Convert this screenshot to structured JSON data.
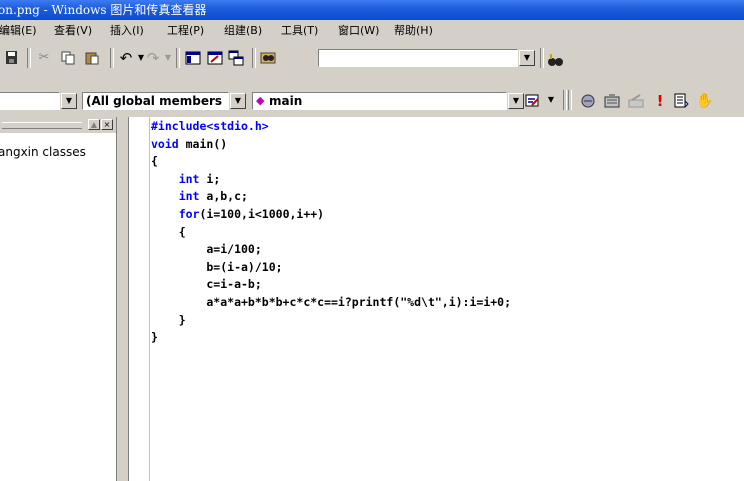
{
  "window": {
    "title": "on.png - Windows 图片和传真查看器"
  },
  "menu": {
    "items": [
      "编辑(E)",
      "查看(V)",
      "插入(I)",
      "工程(P)",
      "组建(B)",
      "工具(T)",
      "窗口(W)",
      "帮助(H)"
    ]
  },
  "toolbar": {
    "find_value": "",
    "icons": [
      "save-all-icon",
      "cut-icon",
      "copy-icon",
      "paste-icon",
      "undo-icon",
      "redo-icon",
      "workspace-icon",
      "output-icon",
      "window-list-icon",
      "find-in-files-icon",
      "find-icon"
    ]
  },
  "wizardbar": {
    "class_value": "",
    "members_value": "(All global members",
    "function_value": "main",
    "build_icons": [
      "compile-icon",
      "build-icon",
      "stop-build-icon",
      "execute-icon",
      "breakpoint-list-icon",
      "hand-icon"
    ]
  },
  "workspace": {
    "tree_item": "angxin classes"
  },
  "editor": {
    "lines": [
      [
        {
          "t": "#include<stdio.h>",
          "kw": true
        }
      ],
      [
        {
          "t": "void",
          "kw": true
        },
        {
          "t": " main()",
          "kw": false
        }
      ],
      [
        {
          "t": "{",
          "kw": false
        }
      ],
      [
        {
          "t": "    ",
          "kw": false
        },
        {
          "t": "int",
          "kw": true
        },
        {
          "t": " i;",
          "kw": false
        }
      ],
      [
        {
          "t": "    ",
          "kw": false
        },
        {
          "t": "int",
          "kw": true
        },
        {
          "t": " a,b,c;",
          "kw": false
        }
      ],
      [
        {
          "t": "    ",
          "kw": false
        },
        {
          "t": "for",
          "kw": true
        },
        {
          "t": "(i=100,i<1000,i++)",
          "kw": false
        }
      ],
      [
        {
          "t": "    {",
          "kw": false
        }
      ],
      [
        {
          "t": "        a=i/100;",
          "kw": false
        }
      ],
      [
        {
          "t": "        b=(i-a)/10;",
          "kw": false
        }
      ],
      [
        {
          "t": "        c=i-a-b;",
          "kw": false
        }
      ],
      [
        {
          "t": "        a*a*a+b*b*b+c*c*c==i?printf(\"%d\\t\",i):i=i+0;",
          "kw": false
        }
      ],
      [
        {
          "t": "    }",
          "kw": false
        }
      ],
      [
        {
          "t": "}",
          "kw": false
        }
      ]
    ]
  }
}
